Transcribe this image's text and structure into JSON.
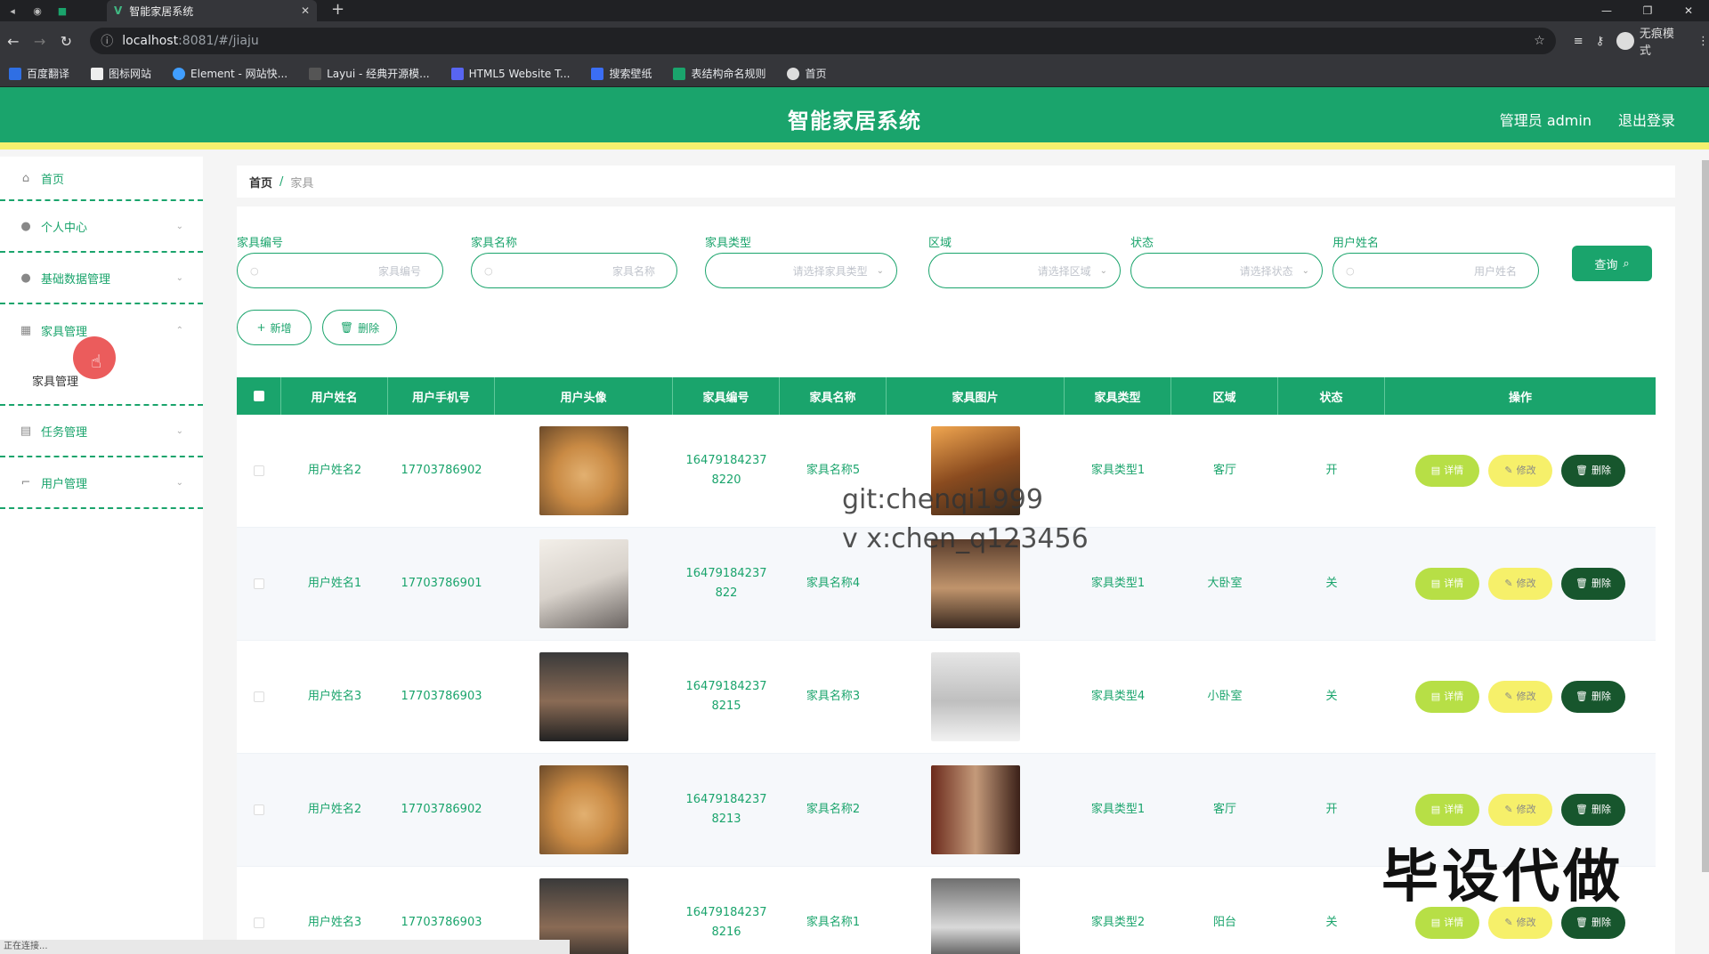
{
  "browser": {
    "tab_title": "智能家居系统",
    "url_host": "localhost",
    "url_path": ":8081/#/jiaju",
    "incognito_label": "无痕模式",
    "bookmarks": [
      "百度翻译",
      "图标网站",
      "Element - 网站快...",
      "Layui - 经典开源模...",
      "HTML5 Website T...",
      "搜索壁纸",
      "表结构命名规则",
      "首页"
    ]
  },
  "header": {
    "title": "智能家居系统",
    "user": "管理员 admin",
    "logout": "退出登录"
  },
  "sidebar": {
    "home": "首页",
    "items": [
      "个人中心",
      "基础数据管理",
      "家具管理",
      "任务管理",
      "用户管理"
    ],
    "sub_item": "家具管理"
  },
  "breadcrumb": {
    "home": "首页",
    "sep": "/",
    "current": "家具"
  },
  "search": {
    "fields": [
      {
        "label": "家具编号",
        "placeholder": "家具编号"
      },
      {
        "label": "家具名称",
        "placeholder": "家具名称"
      },
      {
        "label": "家具类型",
        "placeholder": "请选择家具类型"
      },
      {
        "label": "区域",
        "placeholder": "请选择区域"
      },
      {
        "label": "状态",
        "placeholder": "请选择状态"
      },
      {
        "label": "用户姓名",
        "placeholder": "用户姓名"
      }
    ],
    "query_label": "查询"
  },
  "actions": {
    "add": "新增",
    "delete": "删除"
  },
  "table": {
    "headers": [
      "用户姓名",
      "用户手机号",
      "用户头像",
      "家具编号",
      "家具名称",
      "家具图片",
      "家具类型",
      "区域",
      "状态",
      "操作"
    ],
    "ops": {
      "detail": "详情",
      "edit": "修改",
      "del": "删除"
    },
    "rows": [
      {
        "name": "用户姓名2",
        "phone": "17703786902",
        "code1": "16479184237",
        "code2": "8220",
        "fname": "家具名称5",
        "ftype": "家具类型1",
        "area": "客厅",
        "status": "开"
      },
      {
        "name": "用户姓名1",
        "phone": "17703786901",
        "code1": "16479184237",
        "code2": "822",
        "fname": "家具名称4",
        "ftype": "家具类型1",
        "area": "大卧室",
        "status": "关"
      },
      {
        "name": "用户姓名3",
        "phone": "17703786903",
        "code1": "16479184237",
        "code2": "8215",
        "fname": "家具名称3",
        "ftype": "家具类型4",
        "area": "小卧室",
        "status": "关"
      },
      {
        "name": "用户姓名2",
        "phone": "17703786902",
        "code1": "16479184237",
        "code2": "8213",
        "fname": "家具名称2",
        "ftype": "家具类型1",
        "area": "客厅",
        "status": "开"
      },
      {
        "name": "用户姓名3",
        "phone": "17703786903",
        "code1": "16479184237",
        "code2": "8216",
        "fname": "家具名称1",
        "ftype": "家具类型2",
        "area": "阳台",
        "status": "关"
      }
    ]
  },
  "watermark": {
    "line1": "git:chenqi1999",
    "line2": "v x:chen_q123456",
    "big": "毕设代做"
  },
  "status_bar": "正在连接...",
  "colors": {
    "primary": "#1aa46c",
    "accent_yellow": "#f4f06e",
    "detail": "#b7df46",
    "edit": "#f6f06a",
    "delete": "#17562d"
  }
}
